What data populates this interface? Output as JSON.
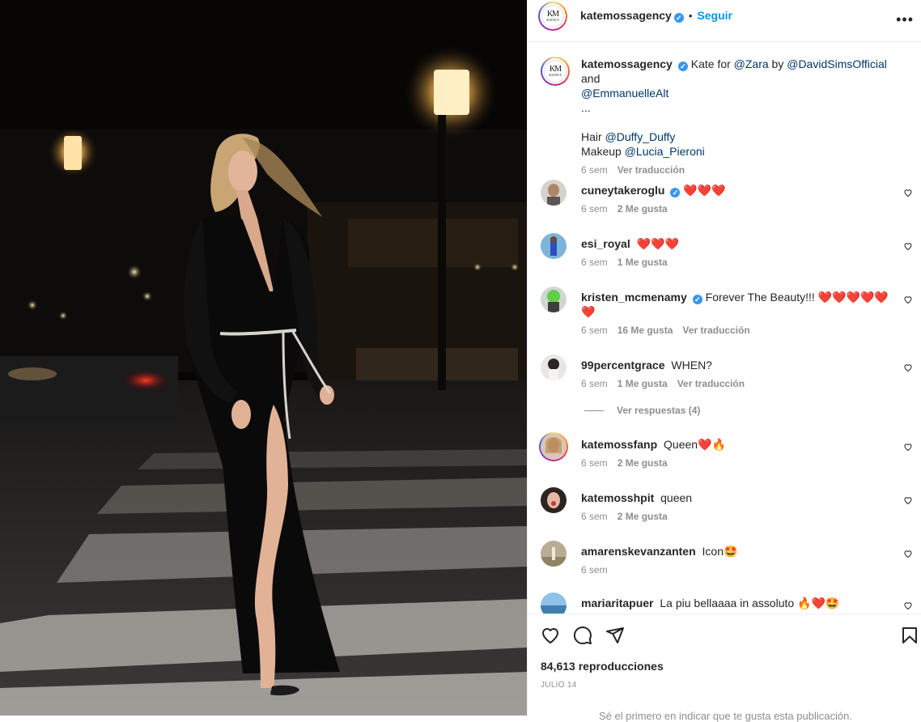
{
  "post": {
    "username": "katemossagency",
    "follow_label": "Seguir",
    "more_label": "•••",
    "verified_mark": "✓",
    "separator": "•"
  },
  "caption": {
    "username": "katemossagency",
    "text_pre": "Kate for ",
    "mention_zara": "@Zara",
    "text_by": " by ",
    "mention_davidsims": "@DavidSimsOfficial",
    "text_and": " and",
    "mention_emmanuelle": "@EmmanuelleAlt",
    "ellipsis": "...",
    "hair_label": "Hair ",
    "mention_duffy": "@Duffy_Duffy",
    "makeup_label": "Makeup ",
    "mention_lucia": "@Lucia_Pieroni",
    "time": "6 sem",
    "translate": "Ver traducción"
  },
  "comments": [
    {
      "username": "cuneytakeroglu",
      "verified": true,
      "text": "",
      "emoji": "❤️❤️❤️",
      "time": "6 sem",
      "likes": "2 Me gusta",
      "translate": ""
    },
    {
      "username": "esi_royal",
      "verified": false,
      "text": "",
      "emoji": "❤️❤️❤️",
      "time": "6 sem",
      "likes": "1 Me gusta",
      "translate": ""
    },
    {
      "username": "kristen_mcmenamy",
      "verified": true,
      "text": "Forever The Beauty!!! ",
      "emoji": "❤️❤️❤️❤️❤️❤️",
      "time": "6 sem",
      "likes": "16 Me gusta",
      "translate": "Ver traducción"
    },
    {
      "username": "99percentgrace",
      "verified": false,
      "text": "WHEN?",
      "emoji": "",
      "time": "6 sem",
      "likes": "1 Me gusta",
      "translate": "Ver traducción"
    },
    {
      "username": "katemossfanp",
      "verified": false,
      "text": "Queen",
      "emoji": "❤️🔥",
      "time": "6 sem",
      "likes": "2 Me gusta",
      "translate": ""
    },
    {
      "username": "katemosshpit",
      "verified": false,
      "text": "queen",
      "emoji": "",
      "time": "6 sem",
      "likes": "2 Me gusta",
      "translate": ""
    },
    {
      "username": "amarenskevanzanten",
      "verified": false,
      "text": "Icon",
      "emoji": "🤩",
      "time": "6 sem",
      "likes": "",
      "translate": ""
    },
    {
      "username": "mariaritapuer",
      "verified": false,
      "text": "La piu bellaaaa in assoluto ",
      "emoji": "🔥❤️🤩",
      "time": "",
      "likes": "",
      "translate": ""
    }
  ],
  "replies_label": "Ver respuestas (4)",
  "stats": {
    "views": "84,613 reproducciones",
    "date": "JULIO 14",
    "footer_partial": "Sé el primero en indicar que te gusta esta publicación."
  },
  "icons": {
    "like": "heart-icon",
    "comment": "comment-icon",
    "share": "paper-plane-icon",
    "save": "bookmark-icon",
    "comment_like": "heart-outline-icon"
  },
  "colors": {
    "link": "#00376b",
    "follow": "#0095f6",
    "verified": "#3897f0",
    "muted": "#8e8e8e",
    "heart": "#ed1c24"
  }
}
